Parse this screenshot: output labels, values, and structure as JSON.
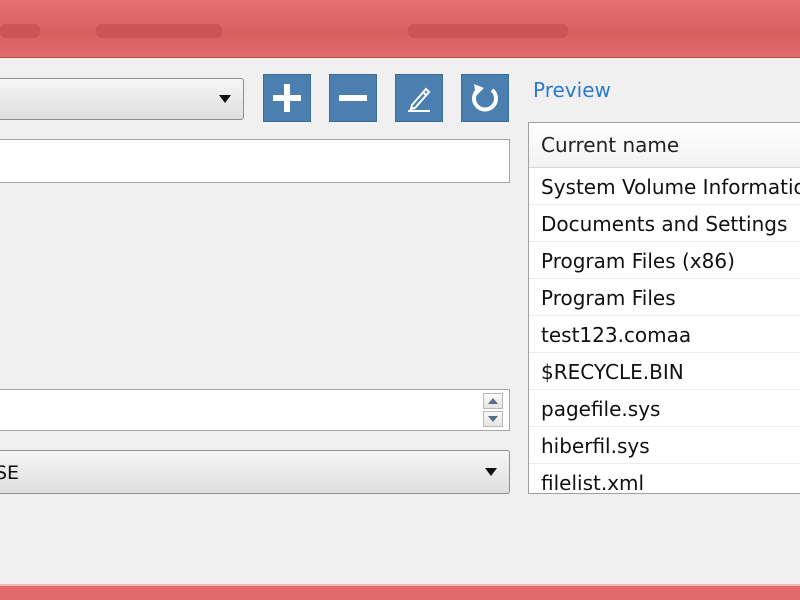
{
  "toolbar": {
    "add_icon": "plus-icon",
    "remove_icon": "minus-icon",
    "edit_icon": "pencil-icon",
    "reset_icon": "refresh-icon",
    "accent": "#4a7fb0"
  },
  "form": {
    "top_combo_value": "",
    "name_field_value": "",
    "number_field_value": "",
    "case_select_value": "SE"
  },
  "preview": {
    "label": "Preview",
    "column_header": "Current name",
    "rows": [
      "System Volume Information",
      "Documents and Settings",
      "Program Files (x86)",
      "Program Files",
      "test123.comaa",
      "$RECYCLE.BIN",
      "pagefile.sys",
      "hiberfil.sys",
      "filelist.xml"
    ]
  }
}
